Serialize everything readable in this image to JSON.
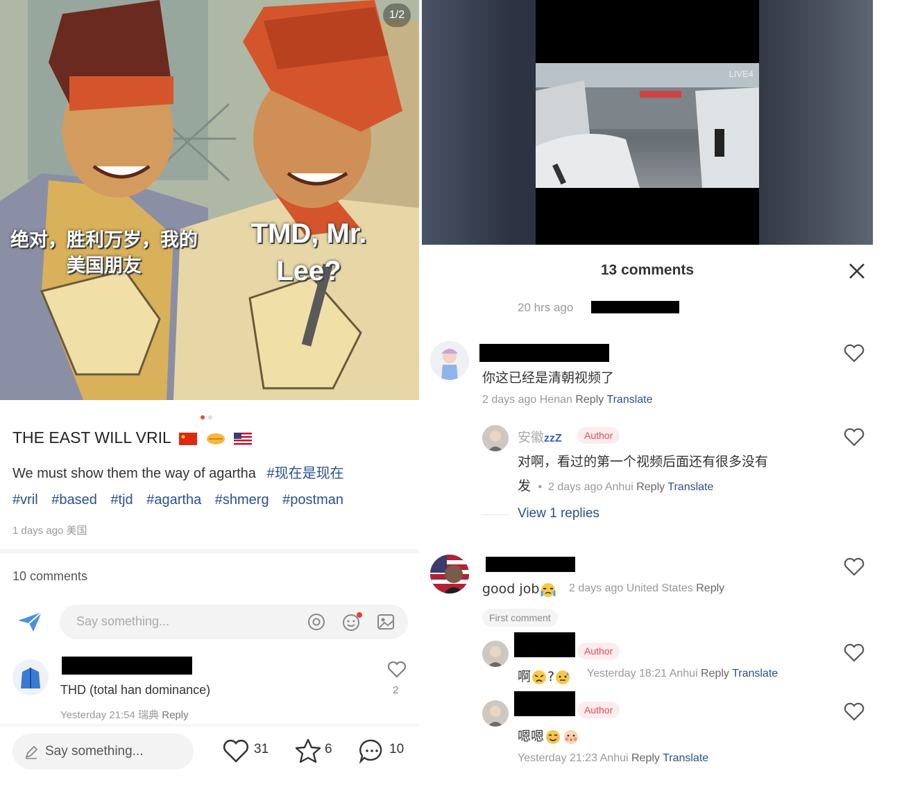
{
  "left": {
    "poster": {
      "page_indicator": "1/2",
      "caption_cn_line1": "绝对，胜利万岁，我的",
      "caption_cn_line2": "美国朋友",
      "caption_en_line1": "TMD, Mr.",
      "caption_en_line2": "Lee?"
    },
    "post": {
      "title": "THE EAST WILL VRIL",
      "body_text": "We must show them the way of agartha",
      "tags": [
        "#现在是现在",
        "#vril",
        "#based",
        "#tjd",
        "#agartha",
        "#shmerg",
        "#postman"
      ],
      "meta": "1 days ago 美国"
    },
    "comments_count": "10 comments",
    "composer_placeholder": "Say something...",
    "comment": {
      "text": "THD (total han dominance)",
      "meta_time": "Yesterday 21:54",
      "meta_location": "瑞典",
      "meta_reply": "Reply",
      "like_count": "2"
    },
    "bottom_bar": {
      "say_placeholder": "Say something...",
      "likes": "31",
      "stars": "6",
      "comments": "10"
    }
  },
  "right": {
    "video": {
      "watermark": "LIVE4"
    },
    "comments_title": "13 comments",
    "post_meta": "20 hrs ago",
    "comments": [
      {
        "text": "你这已经是清朝视频了",
        "meta_time": "2 days ago",
        "meta_location": "Henan",
        "reply": "Reply",
        "translate": "Translate"
      },
      {
        "username": "安徽",
        "username_suffix": "zzZ",
        "badge": "Author",
        "text_line1": "对啊，看过的第一个视频后面还有很多没有",
        "text_line2": "发",
        "meta_time": "2 days ago",
        "meta_location": "Anhui",
        "reply": "Reply",
        "translate": "Translate",
        "view_replies": "View 1 replies"
      },
      {
        "text": "good job",
        "meta_time": "2 days ago",
        "meta_location": "United States",
        "reply": "Reply",
        "first_badge": "First comment"
      },
      {
        "badge": "Author",
        "text": "啊",
        "text_q": "?",
        "meta_time": "Yesterday 18:21",
        "meta_location": "Anhui",
        "reply": "Reply",
        "translate": "Translate"
      },
      {
        "badge": "Author",
        "text": "嗯嗯",
        "meta_time": "Yesterday 21:23",
        "meta_location": "Anhui",
        "reply": "Reply",
        "translate": "Translate"
      }
    ]
  },
  "colors": {
    "tag_blue": "#2b4f8f",
    "author_red": "#e5485c",
    "meta_gray": "#999999",
    "poster_red": "#d4552c"
  }
}
